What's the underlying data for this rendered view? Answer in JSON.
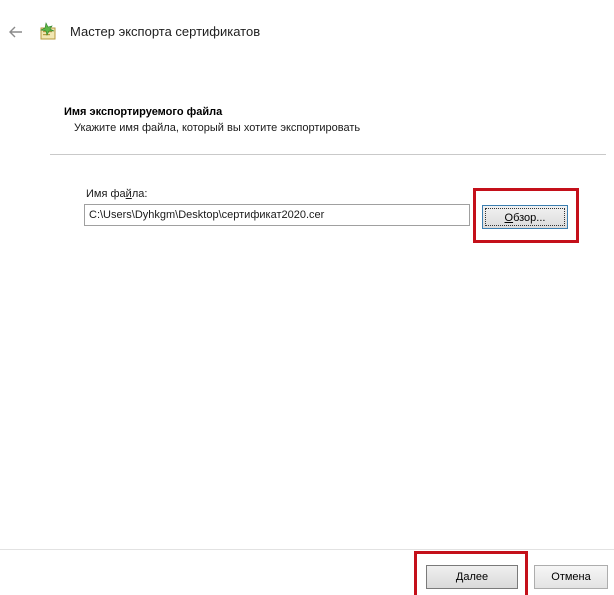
{
  "window": {
    "title": "Мастер экспорта сертификатов",
    "back_icon": "arrow-left-icon",
    "app_icon": "certificate-wizard-icon"
  },
  "section": {
    "title": "Имя экспортируемого файла",
    "subtitle": "Укажите имя файла, который вы хотите экспортировать"
  },
  "file": {
    "label_before": "Имя фа",
    "label_underlined": "й",
    "label_after": "ла:",
    "value": "C:\\Users\\Dyhkgm\\Desktop\\сертификат2020.cer"
  },
  "buttons": {
    "browse_underlined": "О",
    "browse_rest": "бзор...",
    "next_underlined": "Д",
    "next_rest": "алее",
    "cancel": "Отмена"
  },
  "colors": {
    "highlight": "#c4101a",
    "focus_border": "#3c7fb1"
  }
}
